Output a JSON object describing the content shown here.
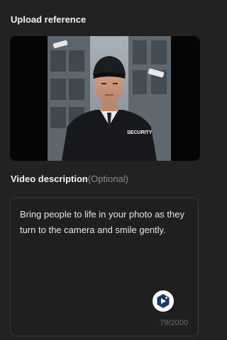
{
  "upload": {
    "title": "Upload reference",
    "image_alt": "Security guard in black jacket and cap",
    "jacket_text": "SECURITY"
  },
  "description": {
    "title": "Video description",
    "optional": "(Optional)",
    "value": "Bring people to life in your photo as they turn to the camera and smile gently.",
    "counter": "79/2000",
    "enhance_icon": "ai-enhance-icon"
  },
  "colors": {
    "background": "#222222",
    "text": "#f2f2f2",
    "muted": "#8c8c8c",
    "accent": "#1a3a66"
  }
}
